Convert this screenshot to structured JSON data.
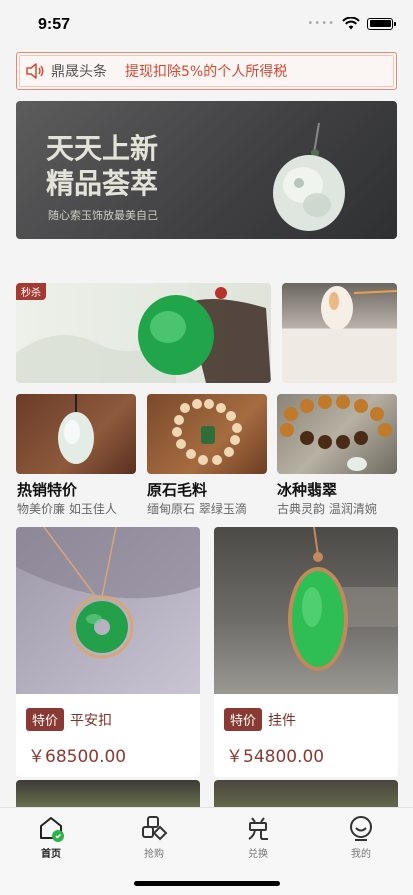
{
  "status_bar": {
    "time": "9:57"
  },
  "news": {
    "label": "鼎晟头条",
    "text": "提现扣除5%的个人所得税"
  },
  "banner": {
    "title_line1": "天天上新",
    "title_line2": "精品荟萃",
    "subtitle": "随心索玉饰放最美自己"
  },
  "promo": {
    "badge": "秒杀"
  },
  "categories": [
    {
      "title": "热销特价",
      "desc": "物美价廉 如玉佳人"
    },
    {
      "title": "原石毛料",
      "desc": "缅甸原石 翠绿玉滴"
    },
    {
      "title": "冰种翡翠",
      "desc": "古典灵韵 温润清婉"
    }
  ],
  "products": [
    {
      "tag": "特价",
      "name": "平安扣",
      "price": "￥68500.00"
    },
    {
      "tag": "特价",
      "name": "挂件",
      "price": "￥54800.00"
    }
  ],
  "tabs": [
    {
      "label": "首页",
      "icon": "home-icon",
      "active": true
    },
    {
      "label": "抢购",
      "icon": "grab-icon"
    },
    {
      "label": "兑换",
      "icon": "exchange-icon"
    },
    {
      "label": "我的",
      "icon": "profile-icon"
    }
  ]
}
